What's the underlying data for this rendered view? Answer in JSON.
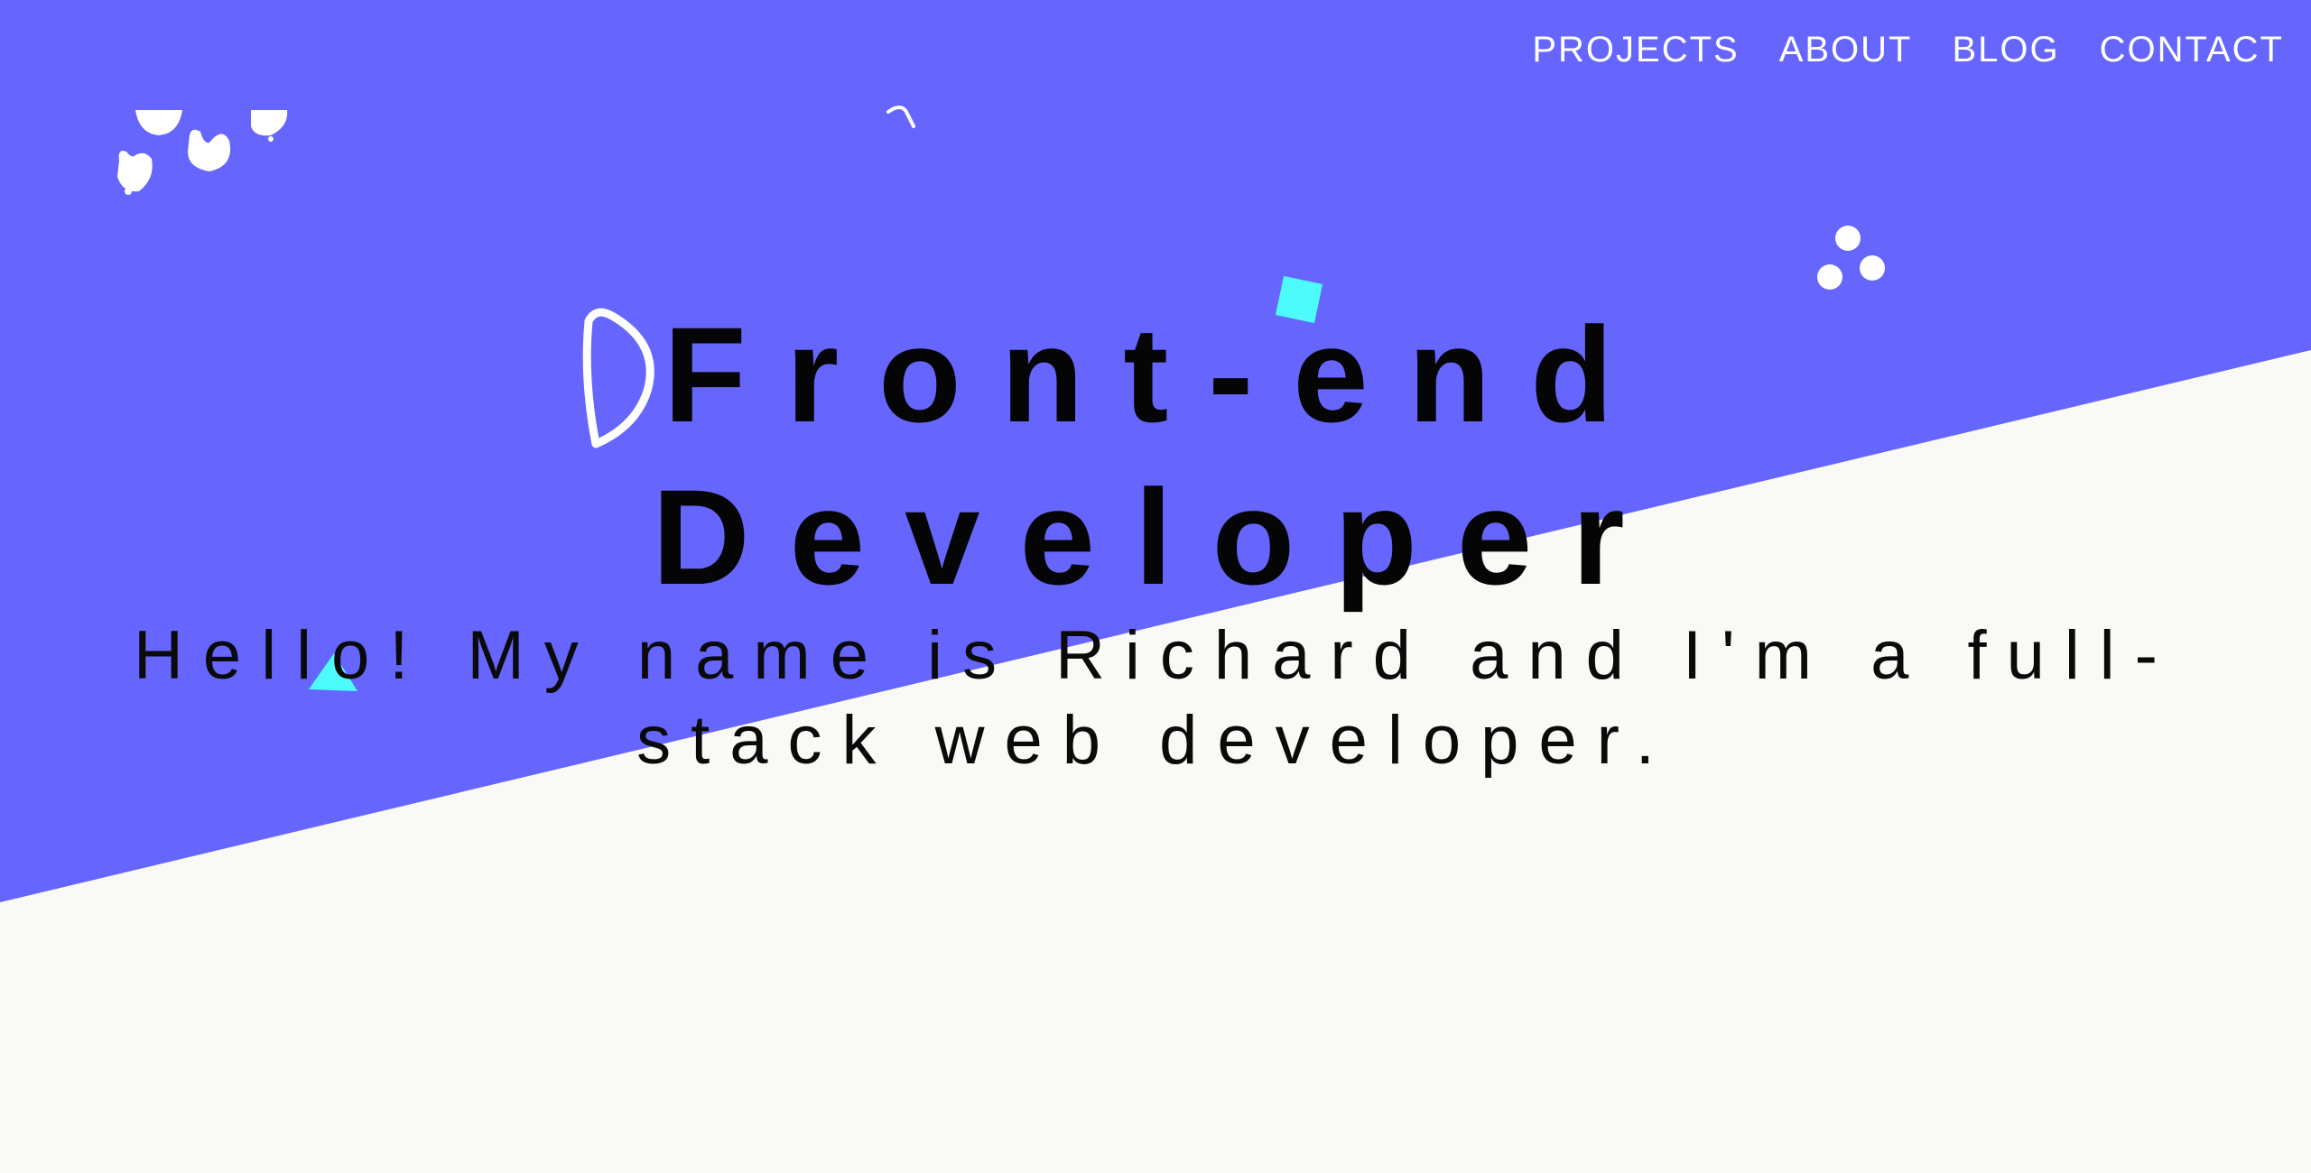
{
  "nav": {
    "items": [
      {
        "label": "PROJECTS"
      },
      {
        "label": "ABOUT"
      },
      {
        "label": "BLOG"
      },
      {
        "label": "CONTACT"
      }
    ]
  },
  "hero": {
    "title_line1": "Front-end",
    "title_line2": "Developer",
    "subtitle": "Hello! My name is Richard and I'm a full-stack web developer."
  },
  "colors": {
    "primary": "#6666ff",
    "background": "#f9f9f6",
    "accent": "#4dfbfb",
    "text": "#050505",
    "nav_text": "#ffffff"
  },
  "decorations": [
    "blob-cluster-icon",
    "curl-icon",
    "dots-cluster-icon",
    "square-icon",
    "leaf-outline-icon",
    "triangle-icon"
  ]
}
